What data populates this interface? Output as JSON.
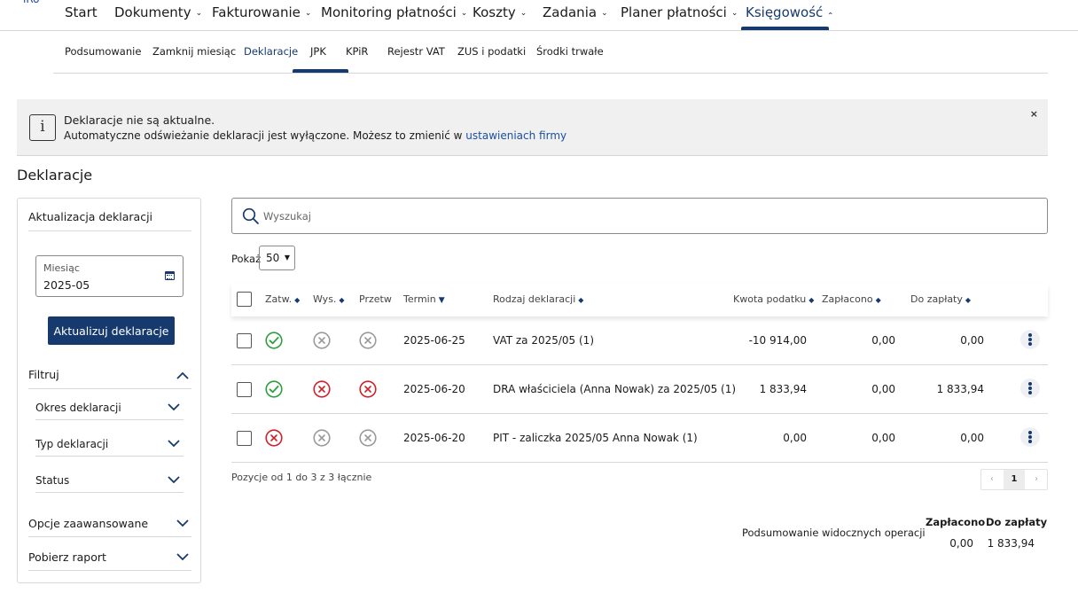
{
  "logo": "iRo",
  "nav": {
    "items": [
      {
        "label": "Start",
        "chevron": false
      },
      {
        "label": "Dokumenty",
        "chevron": true
      },
      {
        "label": "Fakturowanie",
        "chevron": true
      },
      {
        "label": "Monitoring płatności",
        "chevron": true
      },
      {
        "label": "Koszty",
        "chevron": true
      },
      {
        "label": "Zadania",
        "chevron": true
      },
      {
        "label": "Planer płatności",
        "chevron": true
      },
      {
        "label": "Księgowość",
        "chevron": true,
        "active": true
      }
    ]
  },
  "subnav": {
    "items": [
      "Podsumowanie",
      "Zamknij miesiąc",
      "Deklaracje",
      "JPK",
      "KPiR",
      "Rejestr VAT",
      "ZUS i podatki",
      "Środki trwałe"
    ],
    "active": "Deklaracje"
  },
  "alert": {
    "title": "Deklaracje nie są aktualne.",
    "text": "Automatyczne odświeżanie deklaracji jest wyłączone. Możesz to zmienić w",
    "link": "ustawieniach firmy",
    "close": "×"
  },
  "page_title": "Deklaracje",
  "left_panel": {
    "update_heading": "Aktualizacja deklaracji",
    "month_label": "Miesiąc",
    "month_value": "2025-05",
    "update_button": "Aktualizuj deklaracje",
    "filter_heading": "Filtruj",
    "filters": [
      "Okres deklaracji",
      "Typ deklaracji",
      "Status"
    ],
    "advanced": "Opcje zaawansowane",
    "report": "Pobierz raport"
  },
  "search": {
    "placeholder": "Wyszukaj",
    "value": ""
  },
  "show": {
    "label": "Pokaż",
    "value": "50"
  },
  "table": {
    "headers": {
      "approved": "Zatw.",
      "sent": "Wys.",
      "processed": "Przetw",
      "deadline": "Termin",
      "type": "Rodzaj deklaracji",
      "tax_amount": "Kwota podatku",
      "paid": "Zapłacono",
      "to_pay": "Do zapłaty"
    },
    "rows": [
      {
        "approved": "ok",
        "sent": "neutral",
        "processed": "neutral",
        "deadline": "2025-06-25",
        "type": "VAT za 2025/05 (1)",
        "tax_amount": "-10 914,00",
        "paid": "0,00",
        "to_pay": "0,00"
      },
      {
        "approved": "ok",
        "sent": "error",
        "processed": "error",
        "deadline": "2025-06-20",
        "type": "DRA właściciela (Anna Nowak) za 2025/05 (1)",
        "tax_amount": "1 833,94",
        "paid": "0,00",
        "to_pay": "1 833,94"
      },
      {
        "approved": "error",
        "sent": "neutral",
        "processed": "neutral",
        "deadline": "2025-06-20",
        "type": "PIT - zaliczka 2025/05 Anna Nowak (1)",
        "tax_amount": "0,00",
        "paid": "0,00",
        "to_pay": "0,00"
      }
    ]
  },
  "footer": {
    "positions": "Pozycje od 1 do 3 z 3 łącznie",
    "pager": {
      "prev": "‹",
      "current": "1",
      "next": "›"
    }
  },
  "summary": {
    "label": "Podsumowanie widocznych operacji",
    "paid_label": "Zapłacono",
    "to_pay_label": "Do zapłaty",
    "paid": "0,00",
    "to_pay": "1 833,94"
  },
  "colors": {
    "primary": "#163a6e",
    "ok": "#2e9e3e",
    "error": "#d0202a",
    "neutral": "#9a9a9a",
    "link": "#1c4fa0"
  }
}
